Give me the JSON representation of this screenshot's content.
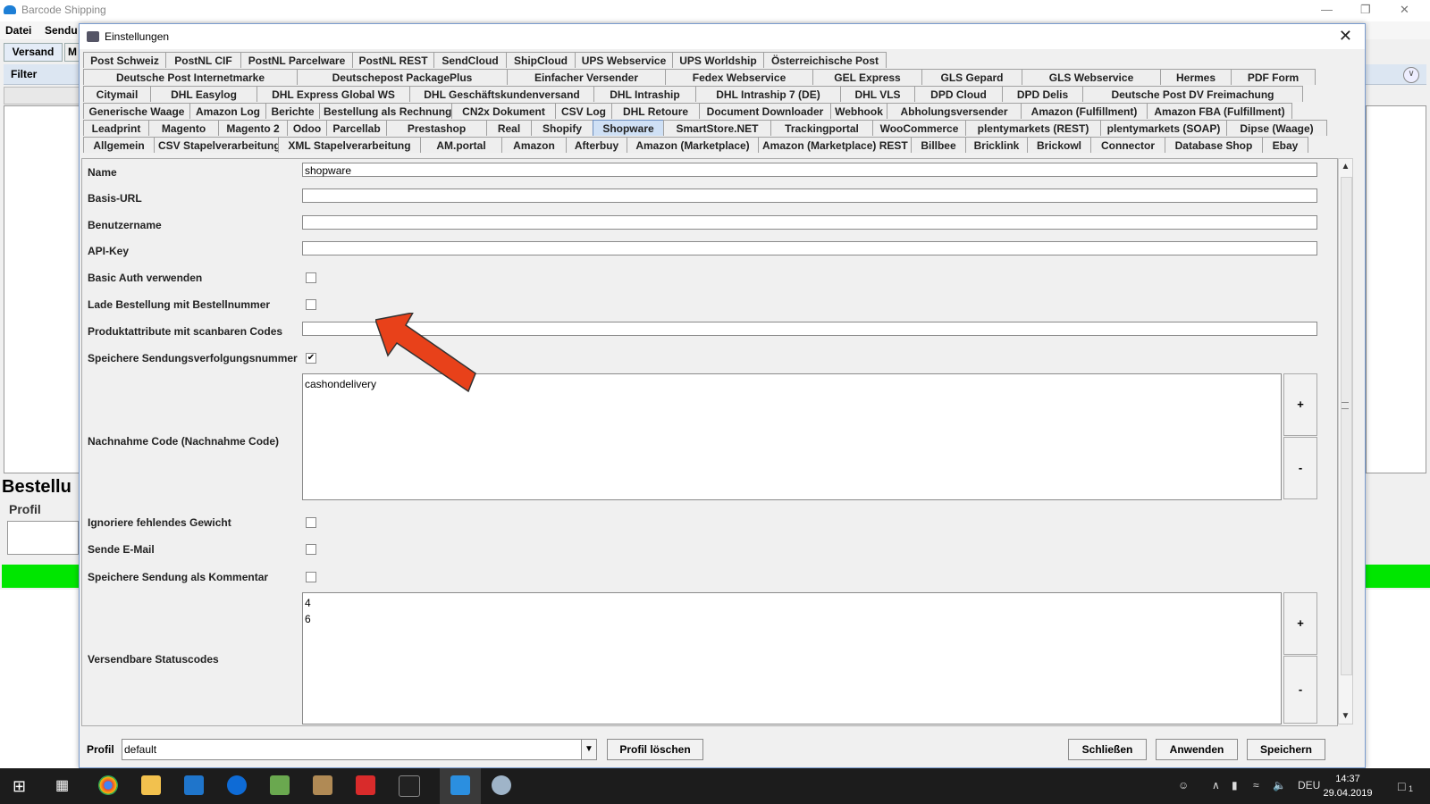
{
  "app": {
    "title": "Barcode Shipping",
    "menu": [
      "Datei",
      "Sendu"
    ],
    "tab_active": "Versand",
    "tab_partial": "M",
    "filter_label": "Filter",
    "section_title": "Bestellu",
    "profile_label": "Profil"
  },
  "dialog": {
    "title": "Einstellungen",
    "tab_rows": [
      [
        "Post Schweiz",
        "PostNL CIF",
        "PostNL Parcelware",
        "PostNL REST",
        "SendCloud",
        "ShipCloud",
        "UPS Webservice",
        "UPS Worldship",
        "Österreichische Post"
      ],
      [
        "Deutsche Post Internetmarke",
        "Deutschepost PackagePlus",
        "Einfacher Versender",
        "Fedex Webservice",
        "GEL Express",
        "GLS Gepard",
        "GLS Webservice",
        "Hermes",
        "PDF Form"
      ],
      [
        "Citymail",
        "DHL Easylog",
        "DHL Express Global WS",
        "DHL Geschäftskundenversand",
        "DHL Intraship",
        "DHL Intraship 7 (DE)",
        "DHL VLS",
        "DPD Cloud",
        "DPD Delis",
        "Deutsche Post DV Freimachung"
      ],
      [
        "Generische Waage",
        "Amazon Log",
        "Berichte",
        "Bestellung als Rechnung",
        "CN2x Dokument",
        "CSV Log",
        "DHL Retoure",
        "Document Downloader",
        "Webhook",
        "Abholungsversender",
        "Amazon (Fulfillment)",
        "Amazon FBA (Fulfillment)"
      ],
      [
        "Leadprint",
        "Magento",
        "Magento 2",
        "Odoo",
        "Parcellab",
        "Prestashop",
        "Real",
        "Shopify",
        "Shopware",
        "SmartStore.NET",
        "Trackingportal",
        "WooCommerce",
        "plentymarkets (REST)",
        "plentymarkets (SOAP)",
        "Dipse (Waage)"
      ],
      [
        "Allgemein",
        "CSV Stapelverarbeitung",
        "XML Stapelverarbeitung",
        "AM.portal",
        "Amazon",
        "Afterbuy",
        "Amazon (Marketplace)",
        "Amazon (Marketplace) REST",
        "Billbee",
        "Bricklink",
        "Brickowl",
        "Connector",
        "Database Shop",
        "Ebay"
      ]
    ],
    "selected_tab": "Shopware",
    "fields": {
      "name_label": "Name",
      "name_value": "shopware",
      "baseurl_label": "Basis-URL",
      "baseurl_value": "",
      "username_label": "Benutzername",
      "username_value": "",
      "apikey_label": "API-Key",
      "apikey_value": "",
      "basicauth_label": "Basic Auth verwenden",
      "basicauth_checked": false,
      "loadorder_label": "Lade Bestellung mit Bestellnummer",
      "loadorder_checked": false,
      "productattr_label": "Produktattribute mit scanbaren Codes",
      "productattr_value": "",
      "savetracking_label": "Speichere Sendungsverfolgungsnummer",
      "savetracking_checked": true,
      "cod_label": "Nachnahme Code (Nachnahme Code)",
      "cod_values": [
        "cashondelivery"
      ],
      "ignoreweight_label": "Ignoriere fehlendes Gewicht",
      "ignoreweight_checked": false,
      "sendmail_label": "Sende E-Mail",
      "sendmail_checked": false,
      "savecomment_label": "Speichere Sendung als Kommentar",
      "savecomment_checked": false,
      "status_label": "Versendbare Statuscodes",
      "status_values": [
        "4",
        "6"
      ],
      "plus": "+",
      "minus": "-"
    },
    "bottom": {
      "profile_label": "Profil",
      "profile_value": "default",
      "delete_profile": "Profil löschen",
      "close": "Schließen",
      "apply": "Anwenden",
      "save": "Speichern"
    }
  },
  "taskbar": {
    "lang": "DEU",
    "time": "14:37",
    "date": "29.04.2019",
    "notifications": "1"
  },
  "colors": {
    "accent_tab": "#cfe0f5",
    "arrow": "#e8411a",
    "status_green": "#00e600"
  }
}
